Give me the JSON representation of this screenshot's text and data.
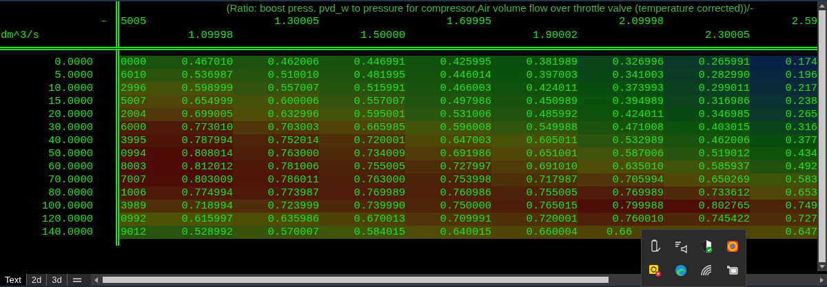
{
  "table": {
    "title": "(Ratio: boost press. pvd_w to pressure for compressor,Air volume flow over throttle valve (temperature corrected))/-",
    "corner": "-",
    "unit": "dm^3/s",
    "column_values": [
      "5005",
      "1.09998",
      "1.30005",
      "1.50000",
      "1.69995",
      "1.90002",
      "2.09998",
      "2.30005",
      "2.59"
    ],
    "rows": [
      {
        "label": "0.0000",
        "cells": [
          "0000",
          "0.467010",
          "0.462006",
          "0.446991",
          "0.425995",
          "0.381989",
          "0.326996",
          "0.265991",
          "0.174"
        ]
      },
      {
        "label": "5.0000",
        "cells": [
          "6010",
          "0.536987",
          "0.510010",
          "0.481995",
          "0.446014",
          "0.397003",
          "0.341003",
          "0.282990",
          "0.196"
        ]
      },
      {
        "label": "10.0000",
        "cells": [
          "2996",
          "0.598999",
          "0.557007",
          "0.515991",
          "0.466003",
          "0.424011",
          "0.373993",
          "0.299011",
          "0.217"
        ]
      },
      {
        "label": "15.0000",
        "cells": [
          "5007",
          "0.654999",
          "0.600006",
          "0.557007",
          "0.497986",
          "0.450989",
          "0.394989",
          "0.316986",
          "0.238"
        ]
      },
      {
        "label": "20.0000",
        "cells": [
          "2004",
          "0.699005",
          "0.632996",
          "0.595001",
          "0.531006",
          "0.485992",
          "0.424011",
          "0.346985",
          "0.265"
        ]
      },
      {
        "label": "30.0000",
        "cells": [
          "6000",
          "0.773010",
          "0.703003",
          "0.665985",
          "0.596008",
          "0.549988",
          "0.471008",
          "0.403015",
          "0.316"
        ]
      },
      {
        "label": "40.0000",
        "cells": [
          "3995",
          "0.787994",
          "0.752014",
          "0.720001",
          "0.647003",
          "0.605011",
          "0.532989",
          "0.462006",
          "0.377"
        ]
      },
      {
        "label": "50.0000",
        "cells": [
          "0994",
          "0.808014",
          "0.763000",
          "0.734009",
          "0.691986",
          "0.651001",
          "0.587006",
          "0.519012",
          "0.434"
        ]
      },
      {
        "label": "60.0000",
        "cells": [
          "8003",
          "0.812012",
          "0.781006",
          "0.755005",
          "0.727997",
          "0.691010",
          "0.635010",
          "0.585937",
          "0.492"
        ]
      },
      {
        "label": "70.0000",
        "cells": [
          "7007",
          "0.803009",
          "0.786011",
          "0.763000",
          "0.753998",
          "0.717987",
          "0.705994",
          "0.650269",
          "0.583"
        ]
      },
      {
        "label": "80.0000",
        "cells": [
          "1006",
          "0.774994",
          "0.773987",
          "0.769989",
          "0.760986",
          "0.755005",
          "0.769989",
          "0.733612",
          "0.653"
        ]
      },
      {
        "label": "100.0000",
        "cells": [
          "3989",
          "0.718994",
          "0.723999",
          "0.739990",
          "0.750000",
          "0.765015",
          "0.799988",
          "0.802765",
          "0.749"
        ]
      },
      {
        "label": "120.0000",
        "cells": [
          "0992",
          "0.615997",
          "0.635986",
          "0.670013",
          "0.709991",
          "0.720001",
          "0.760010",
          "0.745422",
          "0.727"
        ]
      },
      {
        "label": "140.0000",
        "cells": [
          "9012",
          "0.528992",
          "0.570007",
          "0.584015",
          "0.640015",
          "0.660004",
          "0.66",
          null,
          "0.647"
        ]
      }
    ]
  },
  "tabs": [
    {
      "kind": "text",
      "label": "Text",
      "selected": true
    },
    {
      "kind": "text",
      "label": "2d",
      "selected": false
    },
    {
      "kind": "text",
      "label": "3d",
      "selected": false
    },
    {
      "kind": "icon",
      "selected": false
    }
  ],
  "tray_icons": [
    {
      "kind": "usb-drive"
    },
    {
      "kind": "speaker"
    },
    {
      "kind": "shield"
    },
    {
      "kind": "color-ring"
    },
    {
      "kind": "badge"
    },
    {
      "kind": "browser"
    },
    {
      "kind": "wifi"
    },
    {
      "kind": "battery"
    }
  ]
}
